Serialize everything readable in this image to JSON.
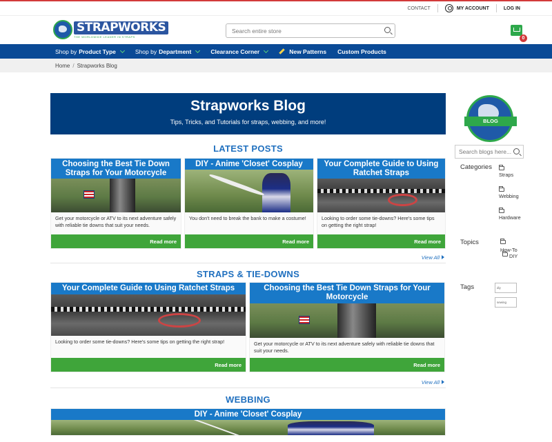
{
  "util": {
    "contact": "CONTACT",
    "my_account": "MY ACCOUNT",
    "login": "LOG IN"
  },
  "header": {
    "logo_name": "STRAPWORKS",
    "logo_tagline": "THE WORLDWIDE LEADER IN STRAPS",
    "search_placeholder": "Search entire store",
    "cart_count": "0"
  },
  "nav": {
    "product_type_prefix": "Shop by ",
    "product_type": "Product Type",
    "department_prefix": "Shop by ",
    "department": "Department",
    "clearance": "Clearance Corner",
    "new_patterns": "New Patterns",
    "custom_products": "Custom Products"
  },
  "breadcrumb": {
    "home": "Home",
    "separator": "/",
    "current": "Strapworks Blog"
  },
  "hero": {
    "title": "Strapworks Blog",
    "subtitle": "Tips, Tricks, and Tutorials for straps, webbing, and more!"
  },
  "latest": {
    "title": "LATEST POSTS",
    "view_all": "View All",
    "posts": [
      {
        "title": "Choosing the Best Tie Down Straps for Your Motorcycle",
        "excerpt": "Get your motorcycle or ATV to its next adventure safely with reliable tie downs that suit your needs.",
        "button": "Read more",
        "image": "motorcycle-tie-down"
      },
      {
        "title": "DIY - Anime 'Closet' Cosplay",
        "excerpt": "You don't need to break the bank to make a costume!",
        "button": "Read more",
        "image": "cosplay"
      },
      {
        "title": "Your Complete Guide to Using Ratchet Straps",
        "excerpt": "Looking to order some tie-downs? Here's some tips on getting the right strap!",
        "button": "Read more",
        "image": "ratchet-strap"
      }
    ]
  },
  "straps": {
    "title": "STRAPS & TIE-DOWNS",
    "view_all": "View All",
    "posts": [
      {
        "title": "Your Complete Guide to Using Ratchet Straps",
        "excerpt": "Looking to order some tie-downs? Here's some tips on getting the right strap!",
        "button": "Read more",
        "image": "ratchet-strap"
      },
      {
        "title": "Choosing the Best Tie Down Straps for Your Motorcycle",
        "excerpt": "Get your motorcycle or ATV to its next adventure safely with reliable tie downs that suit your needs.",
        "button": "Read more",
        "image": "motorcycle-tie-down"
      }
    ]
  },
  "webbing": {
    "title": "WEBBING",
    "posts": [
      {
        "title": "DIY - Anime 'Closet' Cosplay",
        "image": "cosplay"
      }
    ]
  },
  "sidebar": {
    "badge": "BLOG",
    "search_placeholder": "Search blogs here...",
    "categories_label": "Categories",
    "categories": [
      "Straps",
      "Webbing",
      "Hardware"
    ],
    "topics_label": "Topics",
    "topics": [
      "How-To",
      "DIY"
    ],
    "tags_label": "Tags",
    "tags": [
      "diy",
      "sewing"
    ]
  },
  "colors": {
    "nav_blue": "#0a4a96",
    "hero_blue": "#003d7d",
    "card_blue": "#1979c8",
    "green": "#3fa53a",
    "accent_red": "#d23a3a"
  }
}
